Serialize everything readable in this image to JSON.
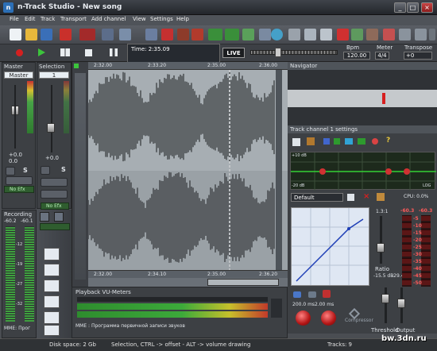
{
  "window": {
    "title": "n-Track Studio - New song",
    "logo": "n"
  },
  "menu": [
    "File",
    "Edit",
    "Track",
    "Transport",
    "Add channel",
    "View",
    "Settings",
    "Help"
  ],
  "transport": {
    "time_label": "Time: 2:35.09",
    "live_label": "LIVE",
    "bpm_label": "Bpm",
    "bpm_value": "120.00",
    "meter_label": "Meter",
    "meter_value": "4/4",
    "transpose_label": "Transpose",
    "transpose_value": "+0"
  },
  "master": {
    "header": "Master",
    "strip_label": "Master",
    "level": "+0.0",
    "pan_val": "0.0",
    "no_fx": "No Efx",
    "selection_header": "Selection",
    "selection_strip": "1",
    "sel_level": "+0.0",
    "sel_no_fx": "No Efx"
  },
  "recording": {
    "header": "Recording",
    "vals": [
      "-60.2",
      "-60.1"
    ],
    "scale": [
      "-12",
      "-19",
      "-27",
      "-32"
    ],
    "mme": "MME: Прог"
  },
  "timeline": {
    "ticks_top": [
      "2:32.00",
      "2:33.20",
      "2:35.00",
      "2:36.00"
    ],
    "ticks_bottom": [
      "2:32.00",
      "2:34.10",
      "2:35.00",
      "2:36.20"
    ]
  },
  "navigator": {
    "title": "Navigator"
  },
  "track_settings": {
    "title": "Track channel 1 settings",
    "db_labels": [
      "+10 dB",
      "-20 dB"
    ],
    "log_label": "LOG",
    "preset": "Default",
    "cpu": "CPU: 0.0%"
  },
  "compressor": {
    "ratio_label": "Ratio",
    "threshold_label": "Threshold",
    "output_label": "Output",
    "ratio_vals": [
      "1.3:1",
      "-15.5 dB",
      "-29.4"
    ],
    "left_val": "-5.0 ms",
    "attack": "200.0 ms",
    "release": "2.00 ms",
    "db_scale_left": [
      "-5",
      "-10",
      "-15",
      "-20",
      "-25",
      "-30",
      "-35",
      "-40",
      "-45",
      "-50"
    ],
    "db_scale_top": [
      "-60.3",
      "-60.3"
    ],
    "meter_marks": [
      "-5",
      "-10",
      "-15",
      "-20",
      "-25",
      "-30",
      "-35",
      "-40",
      "-45",
      "-50"
    ],
    "logo_text": "Compressor"
  },
  "playback": {
    "title": "Playback VU-Meters",
    "mme": "MME : Программа первичной записи звуков"
  },
  "status": {
    "disk": "Disk space: 2 Gb",
    "hint": "Selection, CTRL -> offset - ALT -> volume drawing",
    "tracks": "Tracks: 9"
  },
  "watermark": "bw.3dn.ru",
  "colors": {
    "accent": "#2c6fb6",
    "vu_green": "#3fa03f",
    "record_red": "#d42020",
    "knob_red": "#b31515"
  }
}
